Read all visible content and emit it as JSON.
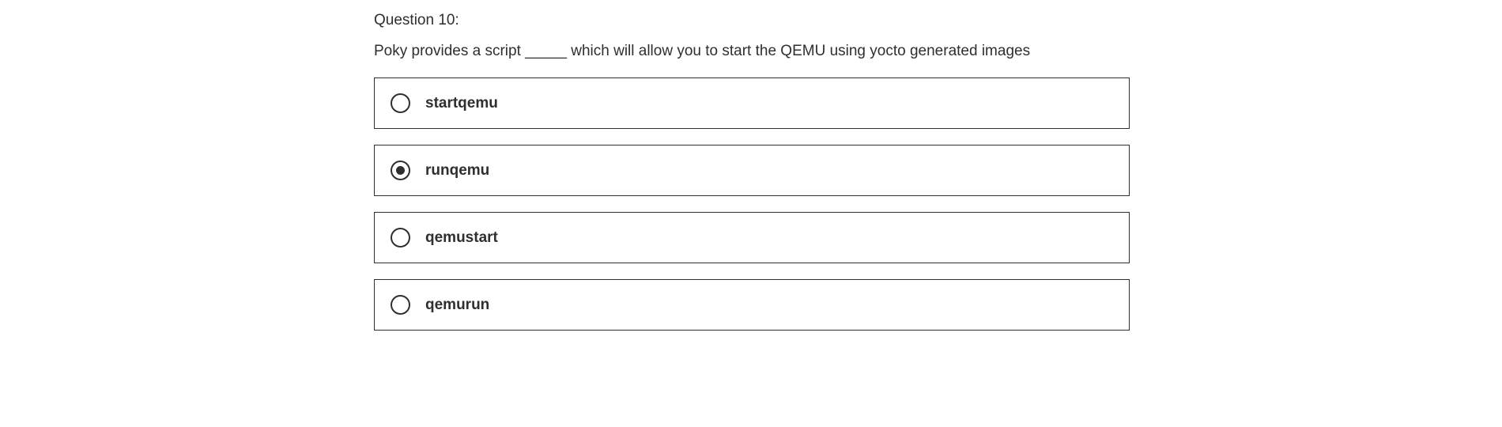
{
  "question": {
    "number_label": "Question 10:",
    "prompt": "Poky provides a script _____ which will allow you to start the QEMU using yocto generated images"
  },
  "options": [
    {
      "label": "startqemu",
      "selected": false
    },
    {
      "label": "runqemu",
      "selected": true
    },
    {
      "label": "qemustart",
      "selected": false
    },
    {
      "label": "qemurun",
      "selected": false
    }
  ],
  "colors": {
    "text": "#2d2f31",
    "border": "#2d2f31",
    "background": "#ffffff"
  },
  "icons": {
    "radio": "radio-button-icon"
  }
}
